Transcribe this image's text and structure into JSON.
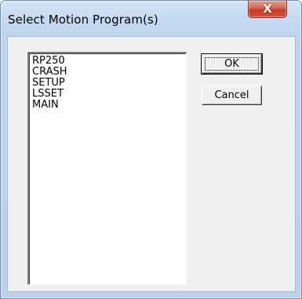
{
  "window": {
    "title": "Select Motion Program(s)",
    "close_glyph": "X"
  },
  "programs": {
    "items": [
      "RP250",
      "CRASH",
      "SETUP",
      "LSSET",
      "MAIN"
    ]
  },
  "buttons": {
    "ok_label": "OK",
    "cancel_label": "Cancel"
  },
  "colors": {
    "title_bar": "#c7dbf2",
    "close_button": "#c43a22",
    "client_bg": "#f0f0f0",
    "list_bg": "#ffffff"
  }
}
